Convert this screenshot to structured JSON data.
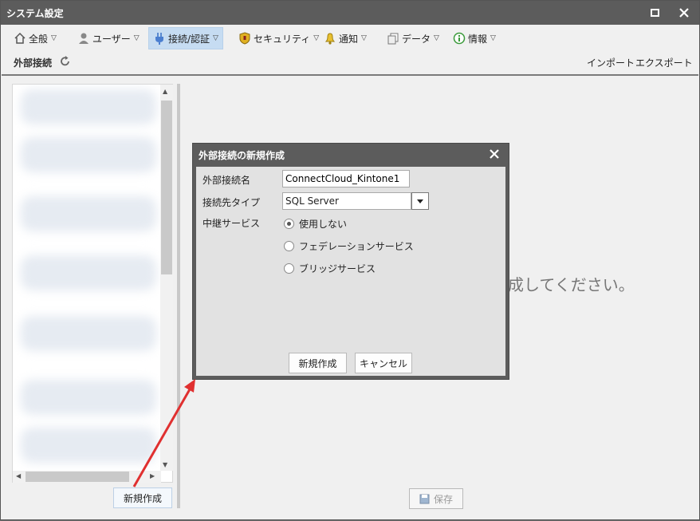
{
  "window": {
    "title": "システム設定"
  },
  "menu": [
    {
      "label": "全般",
      "icon": "home-icon"
    },
    {
      "label": "ユーザー",
      "icon": "user-icon"
    },
    {
      "label": "接続/認証",
      "icon": "plug-icon",
      "active": true
    },
    {
      "label": "セキュリティ",
      "icon": "shield-icon"
    },
    {
      "label": "通知",
      "icon": "bell-icon"
    },
    {
      "label": "データ",
      "icon": "data-icon"
    },
    {
      "label": "情報",
      "icon": "info-icon"
    }
  ],
  "subbar": {
    "title": "外部接続",
    "import": "インポート",
    "export": "エクスポート"
  },
  "main": {
    "message": "成してください。",
    "new_button": "新規作成",
    "save_button": "保存"
  },
  "dialog": {
    "title": "外部接続の新規作成",
    "name_label": "外部接続名",
    "name_value": "ConnectCloud_Kintone1",
    "type_label": "接続先タイプ",
    "type_value": "SQL Server",
    "relay_label": "中継サービス",
    "relay_options": [
      "使用しない",
      "フェデレーションサービス",
      "ブリッジサービス"
    ],
    "relay_selected": 0,
    "create_button": "新規作成",
    "cancel_button": "キャンセル"
  },
  "colors": {
    "titlebar": "#5c5c5c",
    "active_tab": "#c6dcf2",
    "annotation_arrow": "#e03030"
  }
}
